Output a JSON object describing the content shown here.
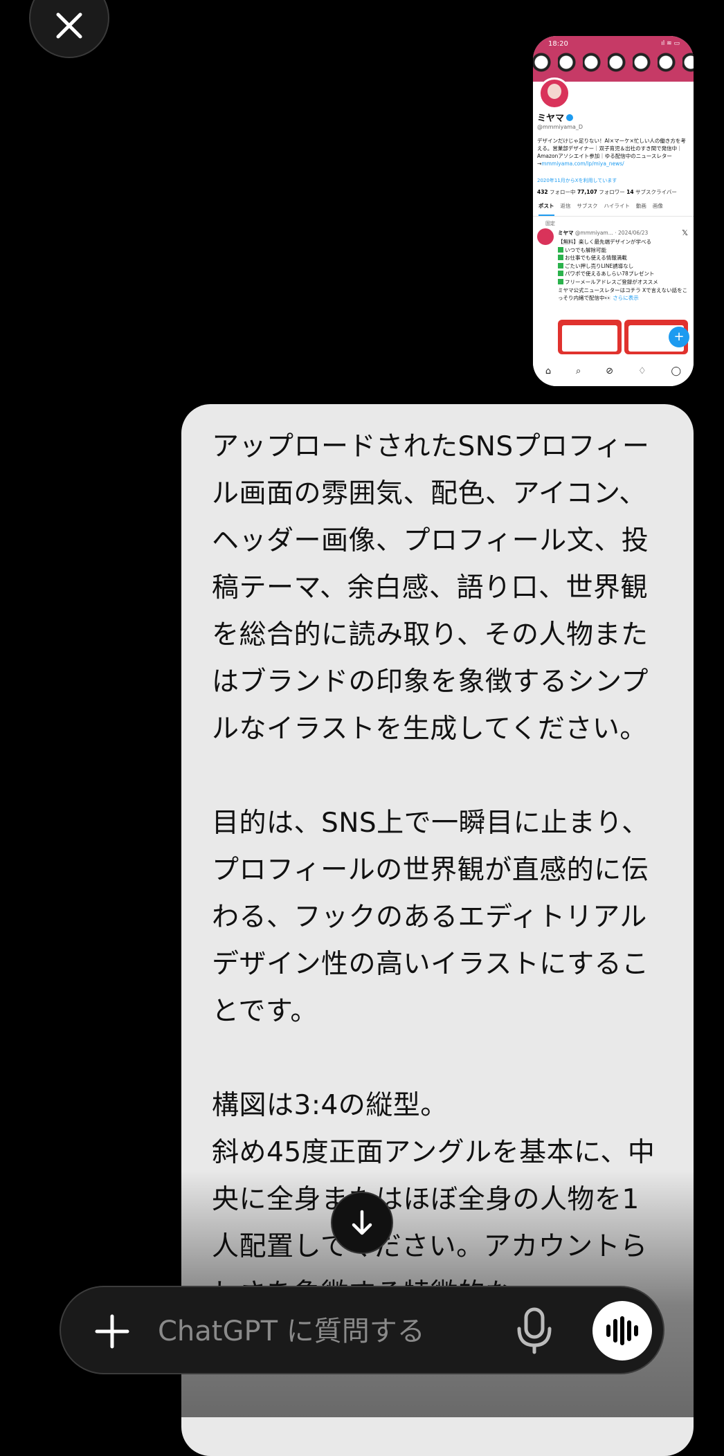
{
  "close_button": {
    "icon": "close-icon"
  },
  "attachment": {
    "status_time": "18:20",
    "status_right": "ıl ≋ ▭",
    "profile_name": "ミヤマ",
    "handle": "@mmmiyama_D",
    "bio": "デザインだけじゃ足りない！AI×マーケ×忙しい人の働き方を考える。営業部デザイナー｜双子育児＆出社のすき間で発信中｜Amazonアソシエイト参加｜ゆる配信中のニュースレター→",
    "bio_link": "mmmiyama.com/lp/miya_news/",
    "joined": "2020年11月からXを利用しています",
    "following_count": "432",
    "following_label": "フォロー中",
    "followers_count": "77,107",
    "followers_label": "フォロワー",
    "subscribers_count": "14",
    "subscribers_label": "サブスクライバー",
    "tabs": [
      "ポスト",
      "返信",
      "サブスク",
      "ハイライト",
      "動画",
      "画像"
    ],
    "pinned_label": "固定",
    "post_author": "ミヤマ",
    "post_meta": "@mmmiyam... · 2024/06/23",
    "post_lines": [
      "【無料】楽しく最先端デザインが学べる",
      "いつでも解除可能",
      "お仕事でも使える情報満載",
      "ごたい押し売りLINE誘導なし",
      "パワポで使えるあしらい78プレゼント",
      "フリーメールアドレスご登録がオススメ"
    ],
    "post_tail": "ミヤマ公式ニュースレターはコチラ Xで言えない話をこっそり内緒で配信中👀",
    "post_more": "さらに表示"
  },
  "message": {
    "paragraphs": [
      "アップロードされたSNSプロフィール画面の雰囲気、配色、アイコン、ヘッダー画像、プロフィール文、投稿テーマ、余白感、語り口、世界観を総合的に読み取り、その人物またはブランドの印象を象徴するシンプルなイラストを生成してください。",
      "目的は、SNS上で一瞬目に止まり、プロフィールの世界観が直感的に伝わる、フックのあるエディトリアルデザイン性の高いイラストにすることです。",
      "構図は3:4の縦型。\n斜め45度正面アングルを基本に、中央に全身またはほぼ全身の人物を1人配置してください。アカウントらしさを象徴する特徴的な"
    ]
  },
  "scroll_down": {
    "icon": "arrow-down-icon"
  },
  "composer": {
    "placeholder": "ChatGPT に質問する",
    "plus_icon": "plus-icon",
    "mic_icon": "microphone-icon",
    "voice_icon": "voice-mode-icon"
  }
}
